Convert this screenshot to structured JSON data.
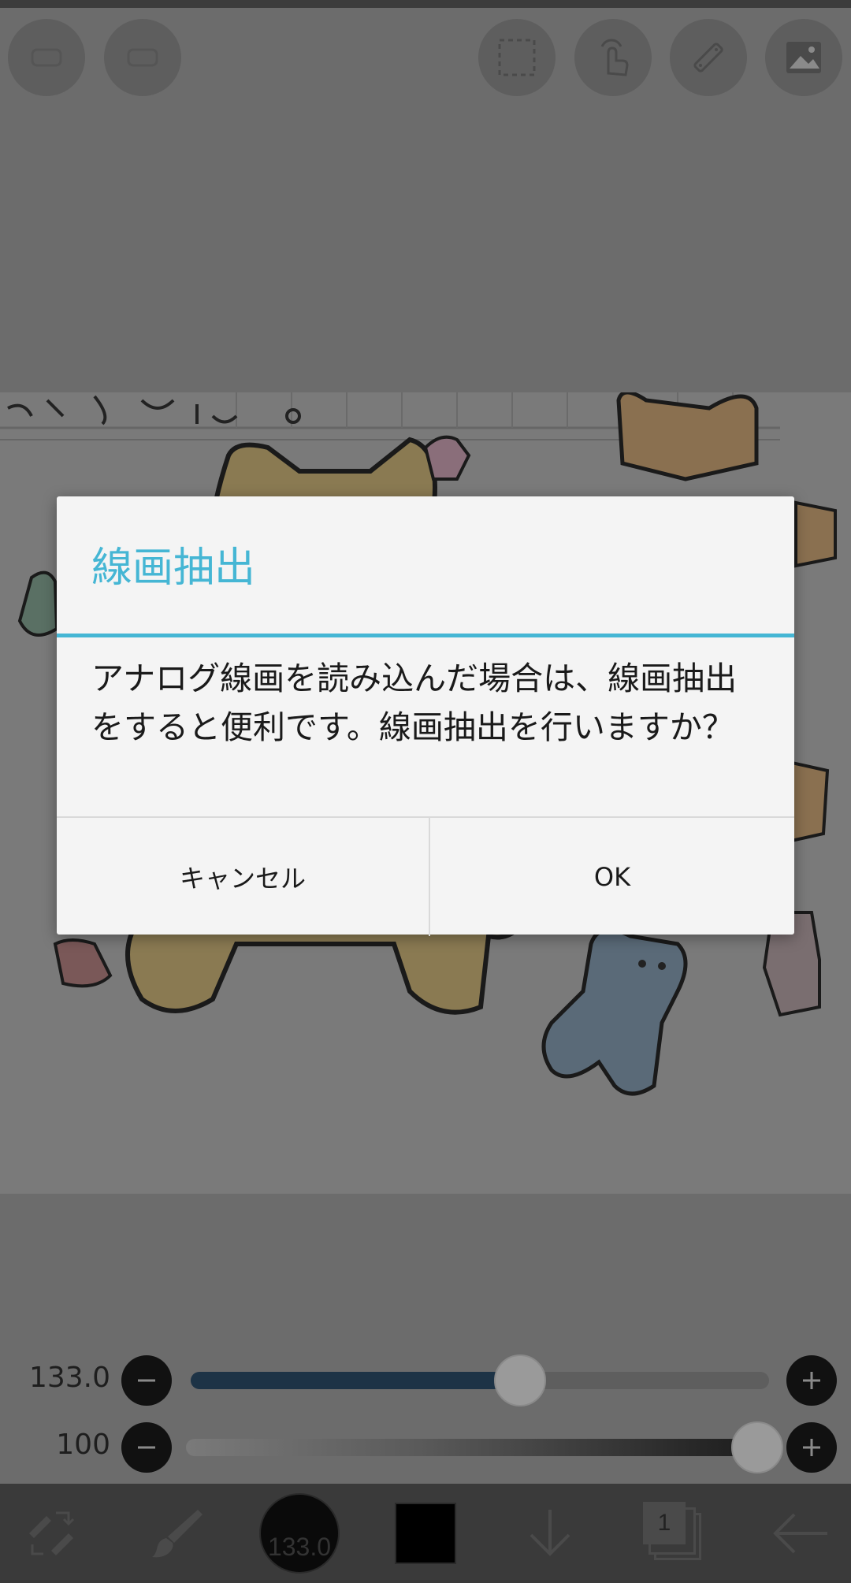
{
  "dialog": {
    "title": "線画抽出",
    "message": "アナログ線画を読み込んだ場合は、線画抽出をすると便利です。線画抽出を行いますか？",
    "cancel_label": "キャンセル",
    "ok_label": "OK"
  },
  "sliders": {
    "brush_size": {
      "label": "133.0",
      "value_fraction": 0.57
    },
    "opacity": {
      "label": "100",
      "value_fraction": 1.0
    }
  },
  "toolbar": {
    "brush_size_label": "133.0",
    "layer_count": "1"
  },
  "colors": {
    "accent": "#45b6d4",
    "overlay": "#6c6c6c",
    "brush_size_track": "#1d3346",
    "current_color": "#000000"
  },
  "icons": {
    "top_left": [
      "layer-icon",
      "layer-icon"
    ],
    "top_right": [
      "selection-icon",
      "touch-gesture-icon",
      "ruler-icon",
      "image-icon"
    ],
    "bottom": [
      "swap-tool-icon",
      "brush-icon",
      "brush-size-preview",
      "color-swatch",
      "download-arrow-icon",
      "layers-icon",
      "back-arrow-icon"
    ]
  }
}
